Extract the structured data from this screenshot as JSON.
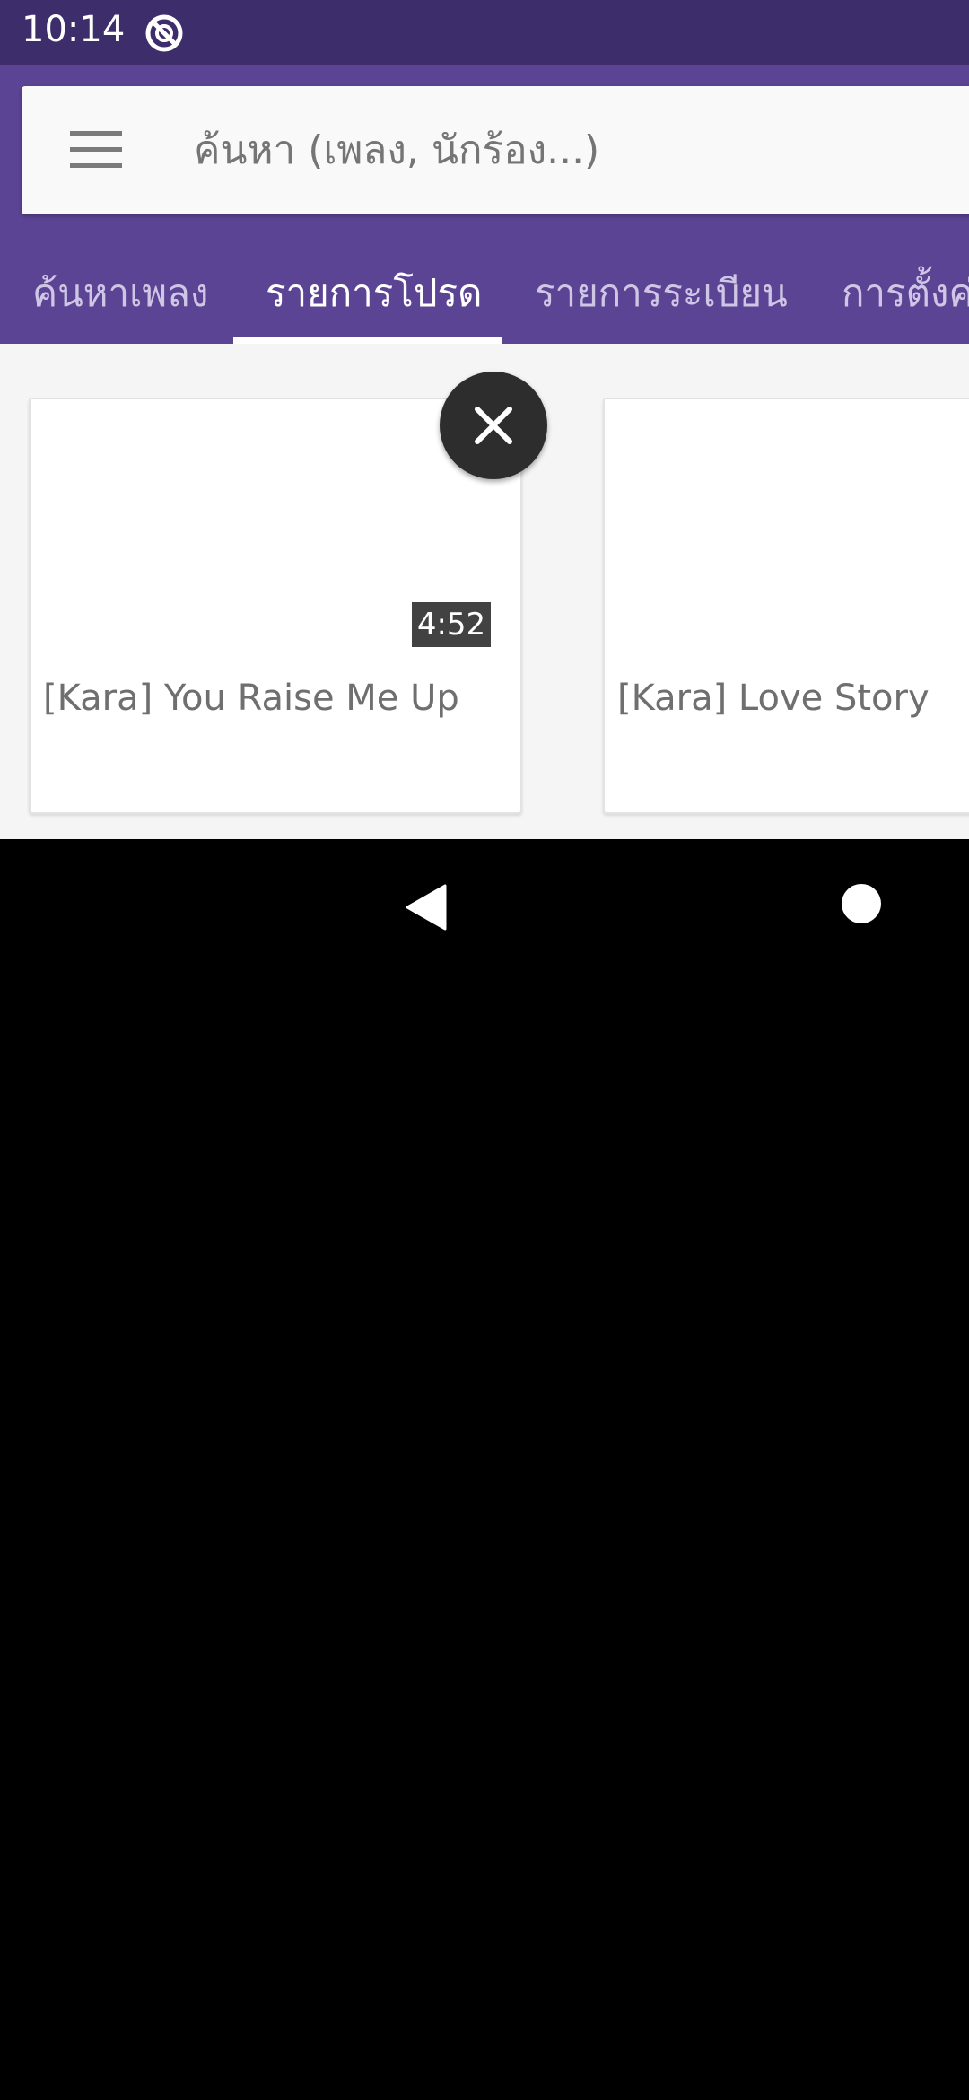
{
  "status_bar": {
    "time": "10:14"
  },
  "search": {
    "placeholder": "ค้นหา (เพลง, นักร้อง...)"
  },
  "tabs": [
    {
      "label": "ค้นหาเพลง"
    },
    {
      "label": "รายการโปรด"
    },
    {
      "label": "รายการระเบียน"
    },
    {
      "label": "การตั้งค่า"
    }
  ],
  "active_tab_index": 1,
  "cards": [
    {
      "title": "[Kara] You Raise Me Up",
      "duration": "4:52"
    },
    {
      "title": "[Kara] Love Story"
    }
  ],
  "colors": {
    "status_bar": "#3d2e6b",
    "header": "#5b4494",
    "active_tab_text": "#ffffff",
    "inactive_tab_text": "#cfc6e6",
    "content_bg": "#f5f5f5",
    "close_button": "#2d2d2d"
  },
  "icons": {
    "status": "no-disturb-icon",
    "menu": "hamburger-menu-icon",
    "close": "close-icon",
    "back": "back-triangle-icon",
    "home": "home-circle-icon"
  }
}
